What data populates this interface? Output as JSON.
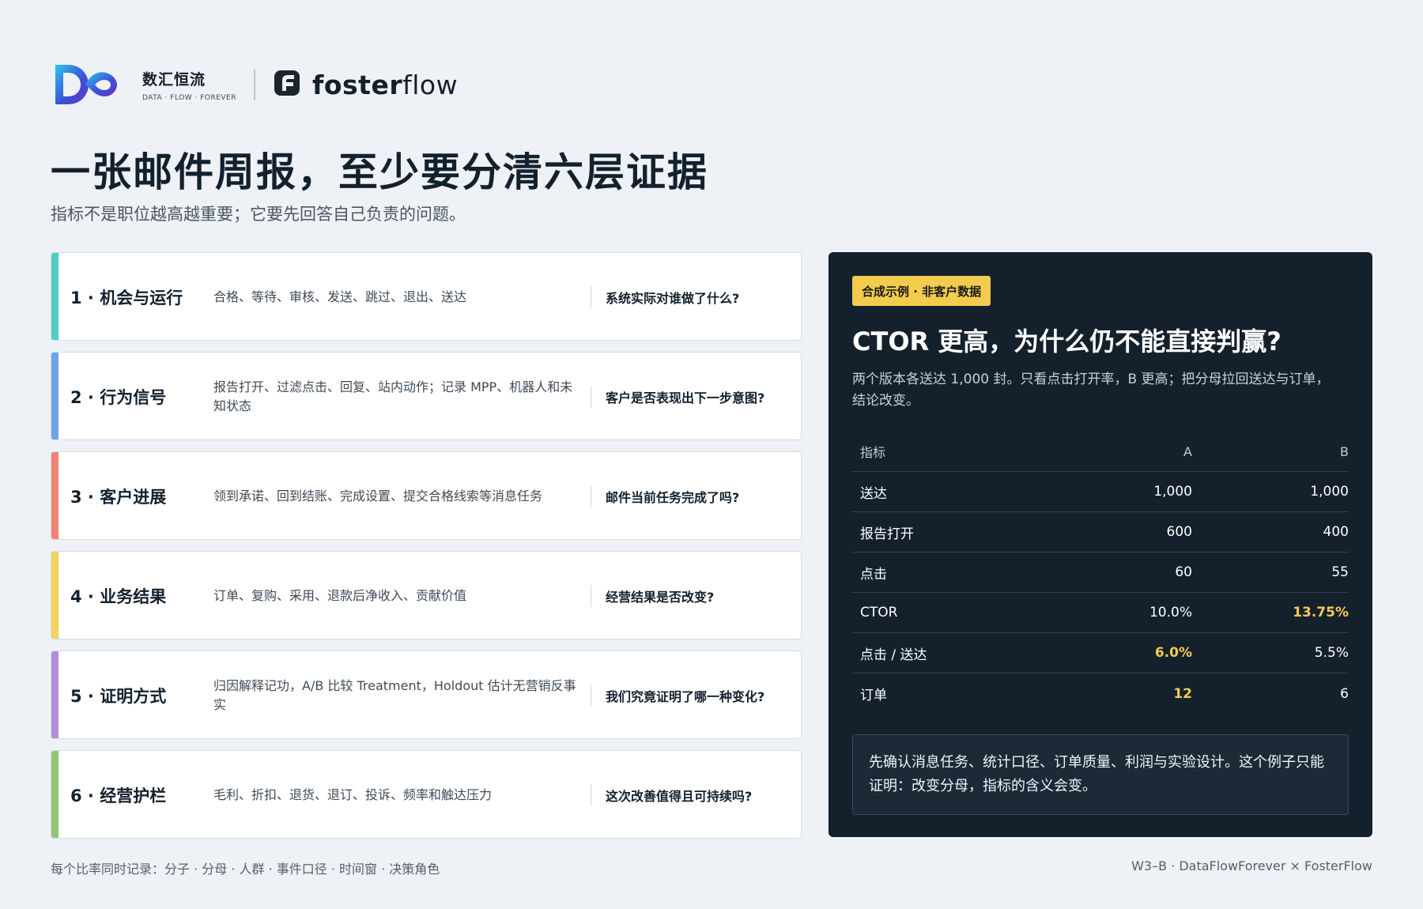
{
  "header": {
    "brand_name": "数汇恒流",
    "brand_tagline": "DATA · FLOW · FOREVER",
    "partner_bold": "foster",
    "partner_light": "flow",
    "brand_logo_icon": "infinity-loop-logo-icon",
    "partner_logo_icon": "fosterflow-f-logo-icon"
  },
  "title": "一张邮件周报，至少要分清六层证据",
  "subtitle": "指标不是职位越高越重要；它要先回答自己负责的问题。",
  "layers": [
    {
      "title": "1 · 机会与运行",
      "description": "合格、等待、审核、发送、跳过、退出、送达",
      "question": "系统实际对谁做了什么?",
      "color": "#4ecdc4"
    },
    {
      "title": "2 · 行为信号",
      "description": "报告打开、过滤点击、回复、站内动作；记录 MPP、机器人和未知状态",
      "question": "客户是否表现出下一步意图?",
      "color": "#6fa3e8"
    },
    {
      "title": "3 · 客户进展",
      "description": "领到承诺、回到结账、完成设置、提交合格线索等消息任务",
      "question": "邮件当前任务完成了吗?",
      "color": "#ef8474"
    },
    {
      "title": "4 · 业务结果",
      "description": "订单、复购、采用、退款后净收入、贡献价值",
      "question": "经营结果是否改变?",
      "color": "#f4d35e"
    },
    {
      "title": "5 · 证明方式",
      "description": "归因解释记功，A/B 比较 Treatment，Holdout 估计无营销反事实",
      "question": "我们究竟证明了哪一种变化?",
      "color": "#b38ddb"
    },
    {
      "title": "6 · 经营护栏",
      "description": "毛利、折扣、退货、退订、投诉、频率和触达压力",
      "question": "这次改善值得且可持续吗?",
      "color": "#8fc773"
    }
  ],
  "panel": {
    "tag": "合成示例 · 非客户数据",
    "title": "CTOR 更高，为什么仍不能直接判赢?",
    "description": "两个版本各送达 1,000 封。只看点击打开率，B 更高；把分母拉回送达与订单，结论改变。",
    "table": {
      "headers": [
        "指标",
        "A",
        "B"
      ],
      "rows": [
        {
          "label": "送达",
          "a": "1,000",
          "b": "1,000",
          "highlight": ""
        },
        {
          "label": "报告打开",
          "a": "600",
          "b": "400",
          "highlight": ""
        },
        {
          "label": "点击",
          "a": "60",
          "b": "55",
          "highlight": ""
        },
        {
          "label": "CTOR",
          "a": "10.0%",
          "b": "13.75%",
          "highlight": "b"
        },
        {
          "label": "点击 / 送达",
          "a": "6.0%",
          "b": "5.5%",
          "highlight": "a"
        },
        {
          "label": "订单",
          "a": "12",
          "b": "6",
          "highlight": "a"
        }
      ]
    },
    "note": "先确认消息任务、统计口径、订单质量、利润与实验设计。这个例子只能证明：改变分母，指标的含义会变。",
    "highlight_color": "#f4cc4d"
  },
  "footer": {
    "left": "每个比率同时记录：分子 · 分母 · 人群 · 事件口径 · 时间窗 · 决策角色",
    "right": "W3–B · DataFlowForever × FosterFlow"
  }
}
